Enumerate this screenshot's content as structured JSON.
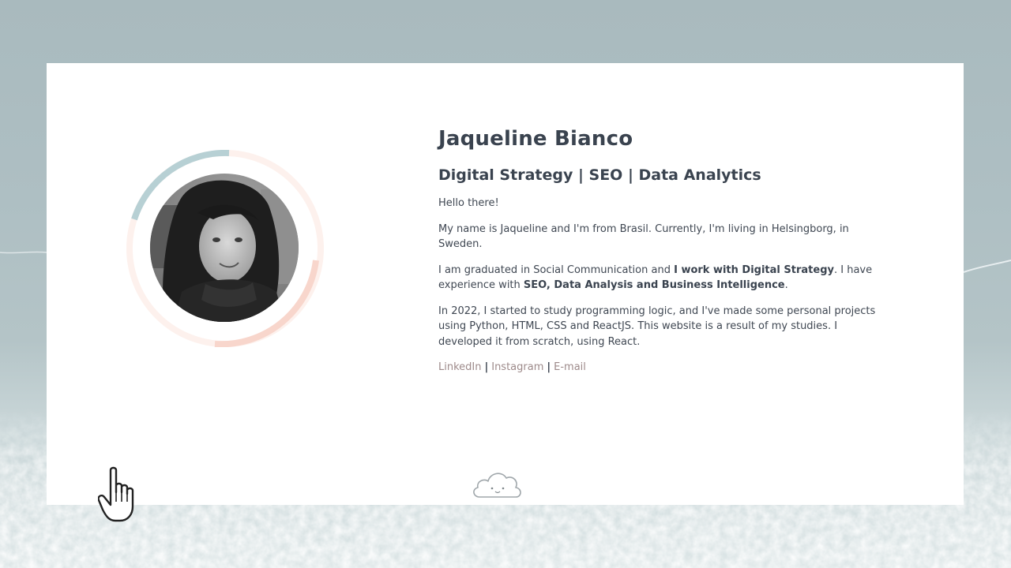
{
  "profile": {
    "name": "Jaqueline Bianco",
    "role": "Digital Strategy | SEO | Data Analytics",
    "greeting": "Hello there!",
    "intro": "My name is Jaqueline and I'm from Brasil. Currently, I'm living in Helsingborg, in Sweden.",
    "work_prefix": "I am graduated in Social Communication and ",
    "work_bold": "I work with Digital Strategy",
    "work_middle": ". I have experience with ",
    "work_bold2": "SEO, Data Analysis and Business Intelligence",
    "work_suffix": ".",
    "studies": "In 2022, I started to study programming logic, and I've made some personal projects using Python, HTML, CSS and ReactJS. This website is a result of my studies. I developed it from scratch, using React."
  },
  "links": {
    "linkedin": "LinkedIn",
    "instagram": "Instagram",
    "email": "E-mail",
    "separator": "|"
  },
  "colors": {
    "ring_blue": "#b7d0d4",
    "ring_peach": "#f8d6cc",
    "ring_light": "#fdf1ed",
    "link_color": "#9d8a8a",
    "text_color": "#3f4752"
  },
  "icons": {
    "cloud": "cloud-icon",
    "cursor": "hand-pointer-icon"
  }
}
